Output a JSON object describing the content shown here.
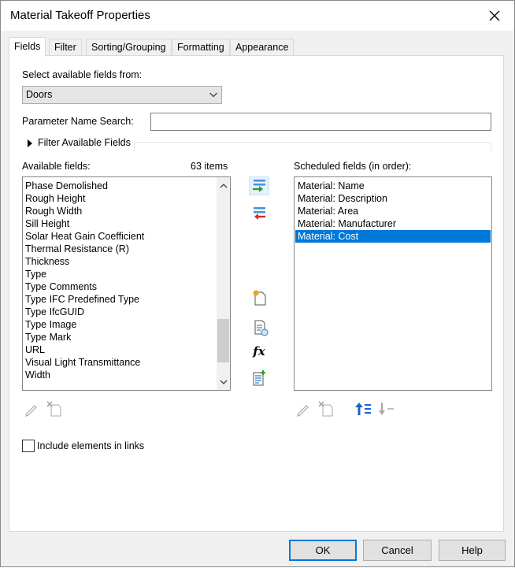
{
  "window": {
    "title": "Material Takeoff Properties",
    "close_icon": "close-icon"
  },
  "tabs": [
    {
      "label": "Fields",
      "active": true
    },
    {
      "label": "Filter",
      "active": false
    },
    {
      "label": "Sorting/Grouping",
      "active": false
    },
    {
      "label": "Formatting",
      "active": false
    },
    {
      "label": "Appearance",
      "active": false
    }
  ],
  "select_fields": {
    "label": "Select available fields from:",
    "value": "Doors"
  },
  "parameter_search": {
    "label": "Parameter Name Search:",
    "value": ""
  },
  "filter_available": {
    "label": "Filter Available Fields",
    "expanded": false
  },
  "available": {
    "label": "Available fields:",
    "count": "63 items",
    "items": [
      "Phase Demolished",
      "Rough Height",
      "Rough Width",
      "Sill Height",
      "Solar Heat Gain Coefficient",
      "Thermal Resistance (R)",
      "Thickness",
      "Type",
      "Type Comments",
      "Type IFC Predefined Type",
      "Type IfcGUID",
      "Type Image",
      "Type Mark",
      "URL",
      "Visual Light Transmittance",
      "Width"
    ],
    "scroll_position": 0.9
  },
  "scheduled": {
    "label": "Scheduled fields (in order):",
    "items": [
      {
        "text": "Material: Name",
        "selected": false
      },
      {
        "text": "Material: Description",
        "selected": false
      },
      {
        "text": "Material: Area",
        "selected": false
      },
      {
        "text": "Material: Manufacturer",
        "selected": false
      },
      {
        "text": "Material: Cost",
        "selected": true
      }
    ]
  },
  "include_links": {
    "label": "Include elements in links",
    "checked": false
  },
  "buttons": {
    "ok": "OK",
    "cancel": "Cancel",
    "help": "Help"
  },
  "colors": {
    "accent": "#0078d7",
    "selection": "#0078d7",
    "hot_bg": "#e5f1fb"
  }
}
